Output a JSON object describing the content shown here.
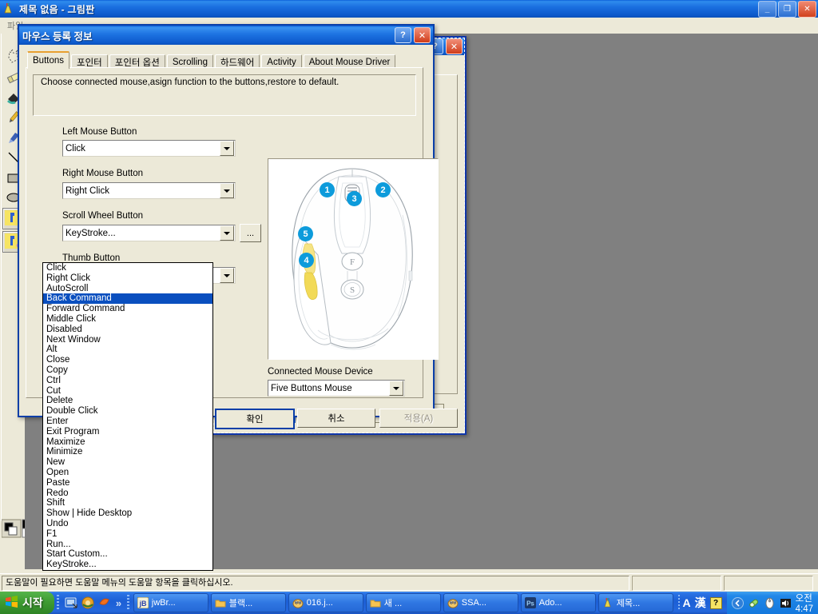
{
  "paint": {
    "title": "제목 없음 - 그림판",
    "menu": [
      "파일"
    ],
    "window_buttons": {
      "minimize": "_",
      "maximize": "❐",
      "close": "✕"
    },
    "status_text": "도움말이 필요하면 도움말 메뉴의 도움말 항목을 클릭하십시오.",
    "tools": [
      "free-form-select-tool",
      "eraser-tool",
      "fill-tool",
      "pencil-tool",
      "brush-tool",
      "line-tool",
      "rectangle-tool",
      "ellipse-tool",
      "text-tool-a",
      "text-tool-b"
    ]
  },
  "back_dialog": {
    "buttons": {
      "ok": "확인",
      "cancel": "취소",
      "apply": "적용(A)"
    },
    "title_buttons": {
      "help": "?",
      "close": "✕"
    }
  },
  "dialog": {
    "title": "마우스 등록 정보",
    "title_buttons": {
      "help": "?",
      "close": "✕"
    },
    "tabs": [
      {
        "label": "Buttons",
        "active": true
      },
      {
        "label": "포인터",
        "active": false
      },
      {
        "label": "포인터 옵션",
        "active": false
      },
      {
        "label": "Scrolling",
        "active": false
      },
      {
        "label": "하드웨어",
        "active": false
      },
      {
        "label": "Activity",
        "active": false
      },
      {
        "label": "About Mouse Driver",
        "active": false
      }
    ],
    "description": "Choose connected mouse,asign function to the buttons,restore to default.",
    "fields": [
      {
        "label": "Left Mouse Button",
        "value": "Click"
      },
      {
        "label": "Right Mouse Button",
        "value": "Right Click"
      },
      {
        "label": "Scroll Wheel Button",
        "value": "KeyStroke..."
      },
      {
        "label": "Thumb Button",
        "value": "Back Command"
      }
    ],
    "ellipsis_button": "...",
    "dropdown": {
      "selected": "Back Command",
      "options": [
        "Click",
        "Right Click",
        "AutoScroll",
        "Back Command",
        "Forward Command",
        "Middle Click",
        "Disabled",
        "Next Window",
        "Alt",
        "Close",
        "Copy",
        "Ctrl",
        "Cut",
        "Delete",
        "Double Click",
        "Enter",
        "Exit Program",
        "Maximize",
        "Minimize",
        "New",
        "Open",
        "Paste",
        "Redo",
        "Shift",
        "Show | Hide Desktop",
        "Undo",
        "F1",
        "Run...",
        "Start Custom...",
        "KeyStroke..."
      ]
    },
    "picture": {
      "callouts": [
        "1",
        "2",
        "3",
        "4",
        "5"
      ],
      "accent_color": "#0d9bdb"
    },
    "connected": {
      "label": "Connected Mouse Device",
      "value": "Five Buttons Mouse"
    },
    "buttons": {
      "ok": "확인",
      "cancel": "취소",
      "apply": "적용(A)"
    }
  },
  "taskbar": {
    "start": "시작",
    "quick_launch": [
      "show-desktop-icon",
      "media-player-icon",
      "browser-icon"
    ],
    "quick_more": "»",
    "tasks": [
      {
        "label": "jwBr...",
        "icon": "jb-icon"
      },
      {
        "label": "블랙...",
        "icon": "folder-icon"
      },
      {
        "label": "016.j...",
        "icon": "image-viewer-icon"
      },
      {
        "label": "새 ...",
        "icon": "folder-icon"
      },
      {
        "label": "SSA...",
        "icon": "image-viewer-icon"
      },
      {
        "label": "Ado...",
        "icon": "photoshop-icon"
      },
      {
        "label": "제목...",
        "icon": "paint-icon"
      }
    ],
    "lang": {
      "input": "A",
      "hanja": "漢",
      "help": "?"
    },
    "tray_icons": [
      "chevron-left-icon",
      "pill-icon",
      "mouse-driver-icon",
      "volume-icon"
    ],
    "clock": "오전 4:47"
  }
}
